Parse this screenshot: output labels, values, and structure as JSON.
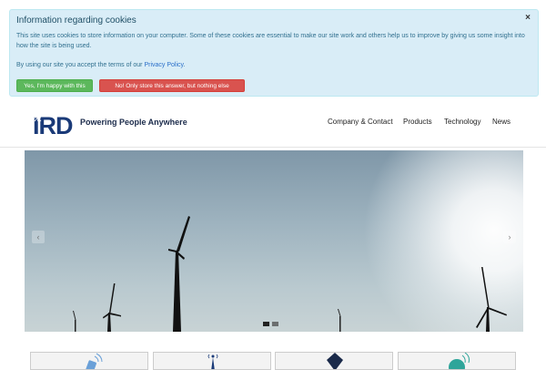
{
  "cookie_notice": {
    "title": "Information regarding cookies",
    "close": "×",
    "paragraph_1": "This site uses cookies to store information on your computer. Some of these cookies are essential to make our site work and others help us to improve by giving us some insight into how the site is being used.",
    "paragraph_2_prefix": "By using our site you accept the terms of our ",
    "privacy_link": "Privacy Policy",
    "paragraph_2_suffix": ".",
    "accept_button": "Yes, I'm happy with this",
    "decline_button": "No! Only store this answer, but nothing else",
    "colors": {
      "background": "#d9edf7",
      "accept": "#5cb85c",
      "decline": "#d9534f"
    }
  },
  "header": {
    "logo_text": "IRD",
    "tagline": "Powering People Anywhere",
    "nav": [
      "Company & Contact",
      "Products",
      "Technology",
      "News"
    ],
    "brand_color": "#1a3a78"
  },
  "slider": {
    "prev_icon": "chevron-left-icon",
    "next_icon": "chevron-right-icon",
    "prev_glyph": "‹",
    "next_glyph": "›",
    "slide_count": 2,
    "active_slide": 1,
    "image_subject": "wind-turbines"
  },
  "tiles": [
    "satellite-phone-icon",
    "radio-tower-icon",
    "shield-icon",
    "signal-globe-icon"
  ]
}
